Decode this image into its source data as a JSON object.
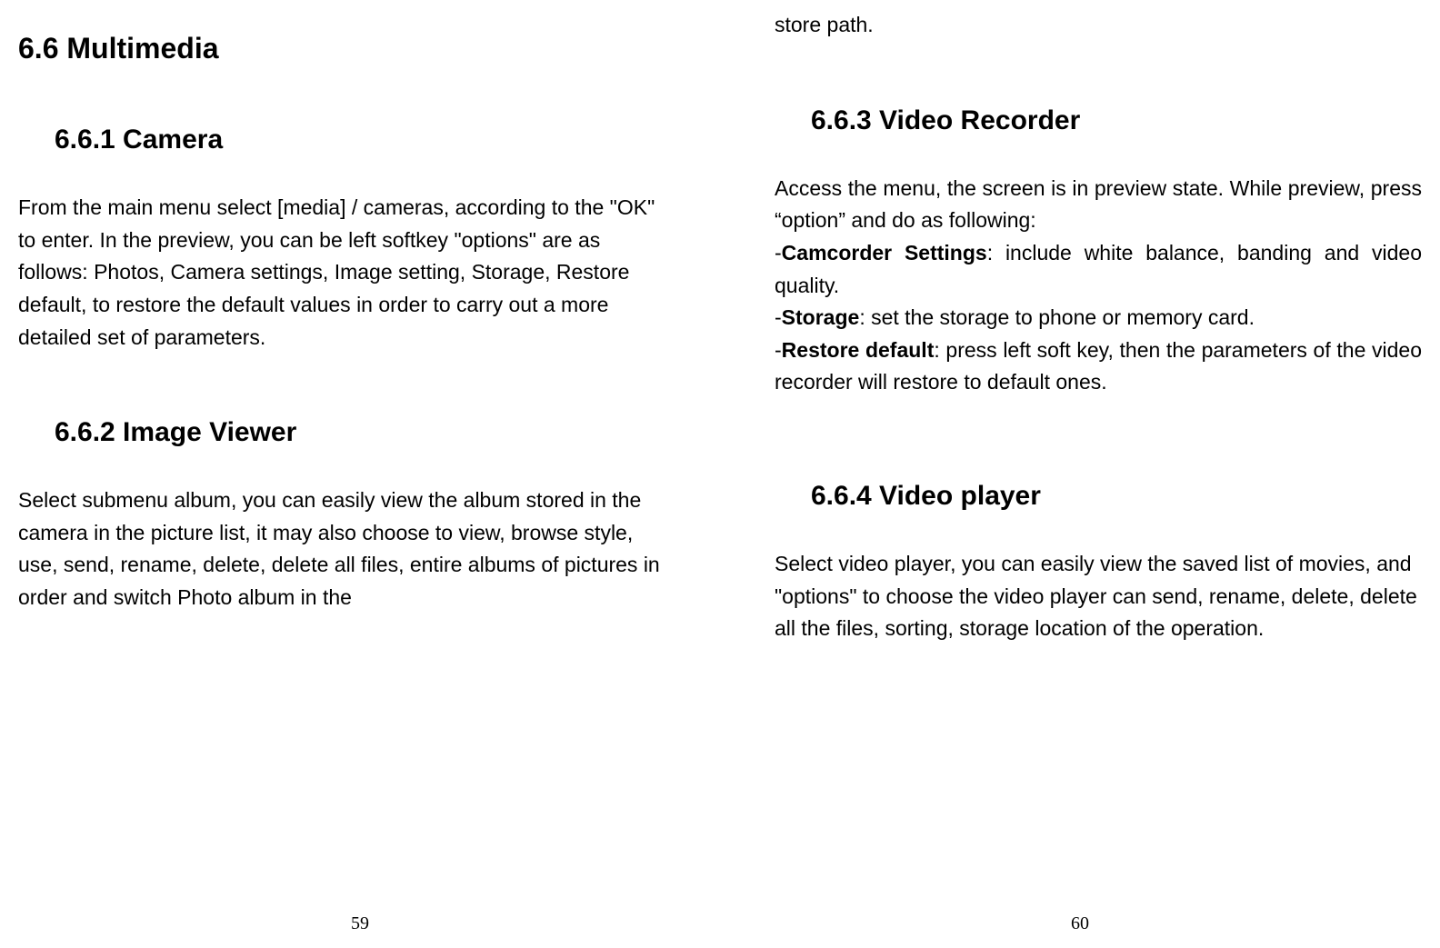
{
  "leftPage": {
    "h1": "6.6  Multimedia",
    "section1": {
      "heading": "6.6.1 Camera",
      "text": "From the main menu select [media] / cameras, according to the \"OK\" to enter. In the preview, you can be left softkey \"options\" are as follows: Photos, Camera settings, Image setting, Storage, Restore default, to restore the default values in order to carry out a more detailed set of parameters."
    },
    "section2": {
      "heading": "6.6.2 Image Viewer",
      "text": "Select submenu album, you can easily view the album stored in the camera in the picture list, it may also choose to view, browse style, use, send, rename, delete, delete all files, entire albums of pictures in order and switch Photo album in the"
    },
    "pageNumber": "59"
  },
  "rightPage": {
    "topLine": "store path.",
    "section1": {
      "heading": "6.6.3 Video Recorder",
      "intro": "Access the menu, the screen is in preview state. While preview, press “option” and do as following:",
      "item1Label": "Camcorder Settings",
      "item1Text": ": include white balance, banding and video quality.",
      "item2Label": "Storage",
      "item2Text": ": set the storage to phone or memory card.",
      "item3Label": "Restore default",
      "item3Text": ": press left soft key, then the parameters of the video recorder will restore to default ones."
    },
    "section2": {
      "heading": "6.6.4 Video player",
      "text": "Select video player, you can easily view the saved list of movies, and \"options\" to choose the video player can send, rename, delete, delete all the files, sorting, storage location of the operation."
    },
    "pageNumber": "60"
  }
}
